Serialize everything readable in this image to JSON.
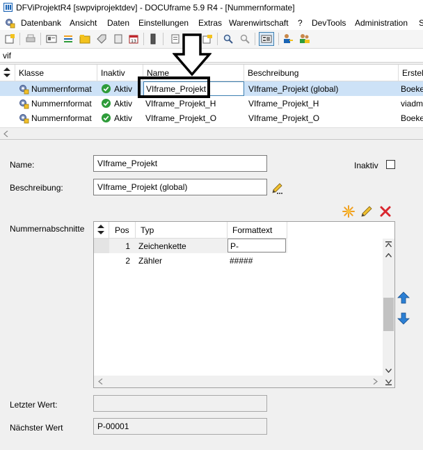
{
  "window": {
    "title": "DFViProjektR4 [swpviprojektdev] - DOCUframe 5.9 R4 - [Nummernformate]"
  },
  "menu": {
    "items": [
      {
        "label": "Datenbank"
      },
      {
        "label": "Ansicht"
      },
      {
        "label": "Daten"
      },
      {
        "label": "Einstellungen"
      },
      {
        "label": "Extras"
      },
      {
        "label": "Warenwirtschaft"
      },
      {
        "label": "?"
      },
      {
        "label": "DevTools"
      },
      {
        "label": "Administration"
      },
      {
        "label": "S"
      }
    ]
  },
  "filter": {
    "value": "vif"
  },
  "grid": {
    "columns": [
      "Klasse",
      "Inaktiv",
      "Name",
      "Beschreibung",
      "Erstell"
    ],
    "rows": [
      {
        "klasse": "Nummernformat",
        "inaktiv": "Aktiv",
        "name": "VIframe_Projekt",
        "beschreibung": "VIframe_Projekt (global)",
        "erstell": "Boeke"
      },
      {
        "klasse": "Nummernformat",
        "inaktiv": "Aktiv",
        "name": "VIframe_Projekt_H",
        "beschreibung": "VIframe_Projekt_H",
        "erstell": "viadm"
      },
      {
        "klasse": "Nummernformat",
        "inaktiv": "Aktiv",
        "name": "VIframe_Projekt_O",
        "beschreibung": "VIframe_Projekt_O",
        "erstell": "Boeke"
      }
    ]
  },
  "form": {
    "name_label": "Name:",
    "name_value": "VIframe_Projekt",
    "beschreibung_label": "Beschreibung:",
    "beschreibung_value": "VIframe_Projekt (global)",
    "inaktiv_label": "Inaktiv",
    "abschnitte_label": "Nummernabschnitte",
    "letzter_label": "Letzter Wert:",
    "letzter_value": "",
    "naechster_label": "Nächster Wert",
    "naechster_value": "P-00001"
  },
  "subgrid": {
    "columns": [
      "Pos",
      "Typ",
      "Formattext"
    ],
    "rows": [
      {
        "pos": "1",
        "typ": "Zeichenkette",
        "formattext": "P-"
      },
      {
        "pos": "2",
        "typ": "Zähler",
        "formattext": "#####"
      }
    ]
  },
  "colors": {
    "selection": "#cde2f7",
    "accent": "#1a64b4",
    "ok_green": "#2e9c3a",
    "delete_red": "#d9262e",
    "new_orange": "#f0a020"
  },
  "icons": [
    "app-icon",
    "gear-icon",
    "check-circle-icon",
    "pencil-icon",
    "new-star-icon",
    "delete-x-icon",
    "arrow-up-icon",
    "arrow-down-icon",
    "sort-icon",
    "search-icon",
    "down-arrow-indicator-icon"
  ]
}
